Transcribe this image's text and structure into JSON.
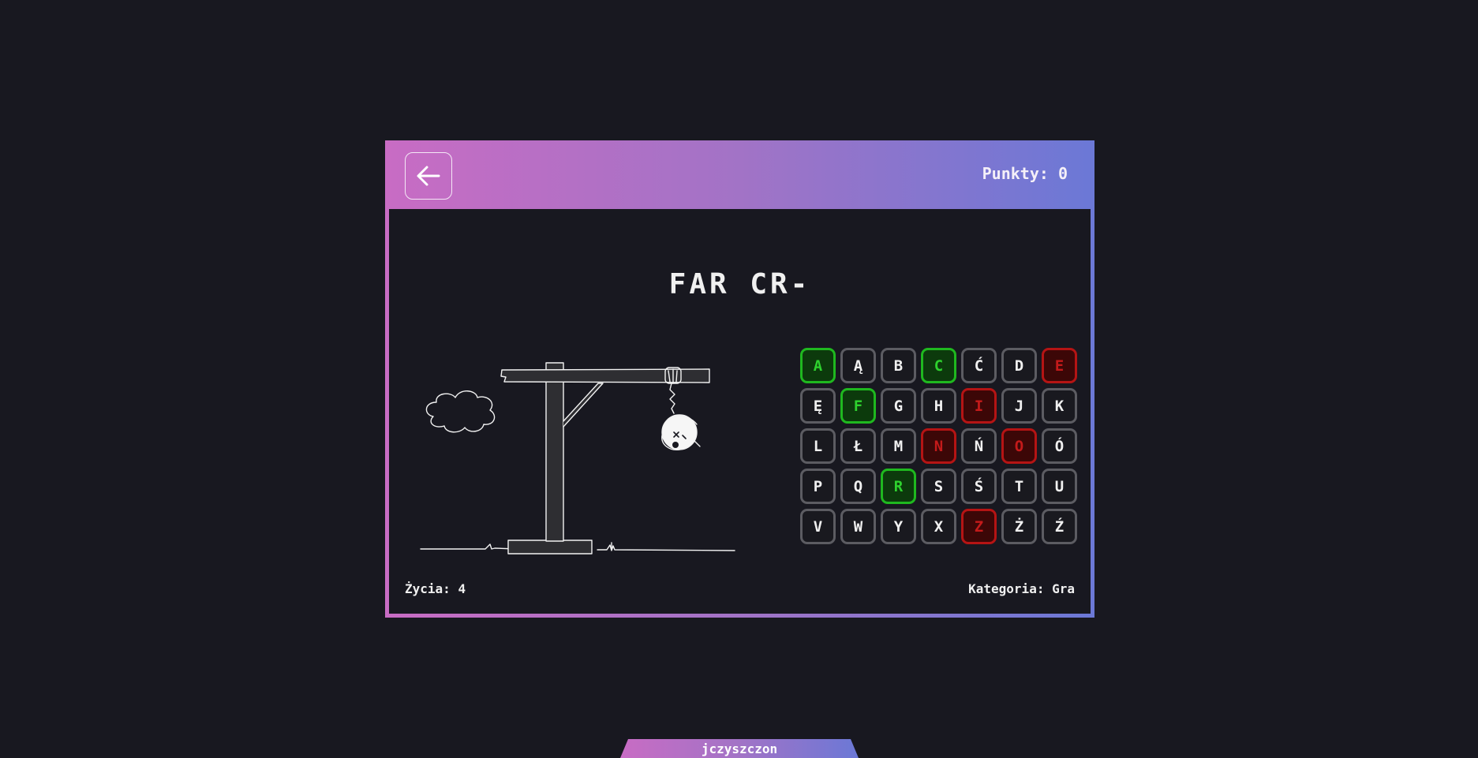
{
  "header": {
    "back_icon": "arrow-left-icon",
    "score_label": "Punkty:",
    "score_value": "0"
  },
  "game": {
    "word": "FAR CR-",
    "lives_label": "Życia:",
    "lives_value": "4",
    "category_label": "Kategoria:",
    "category_value": "Gra"
  },
  "keyboard": [
    {
      "letter": "A",
      "state": "correct"
    },
    {
      "letter": "Ą",
      "state": "default"
    },
    {
      "letter": "B",
      "state": "default"
    },
    {
      "letter": "C",
      "state": "correct"
    },
    {
      "letter": "Ć",
      "state": "default"
    },
    {
      "letter": "D",
      "state": "default"
    },
    {
      "letter": "E",
      "state": "wrong"
    },
    {
      "letter": "Ę",
      "state": "default"
    },
    {
      "letter": "F",
      "state": "correct"
    },
    {
      "letter": "G",
      "state": "default"
    },
    {
      "letter": "H",
      "state": "default"
    },
    {
      "letter": "I",
      "state": "wrong"
    },
    {
      "letter": "J",
      "state": "default"
    },
    {
      "letter": "K",
      "state": "default"
    },
    {
      "letter": "L",
      "state": "default"
    },
    {
      "letter": "Ł",
      "state": "default"
    },
    {
      "letter": "M",
      "state": "default"
    },
    {
      "letter": "N",
      "state": "wrong"
    },
    {
      "letter": "Ń",
      "state": "default"
    },
    {
      "letter": "O",
      "state": "wrong"
    },
    {
      "letter": "Ó",
      "state": "default"
    },
    {
      "letter": "P",
      "state": "default"
    },
    {
      "letter": "Q",
      "state": "default"
    },
    {
      "letter": "R",
      "state": "correct"
    },
    {
      "letter": "S",
      "state": "default"
    },
    {
      "letter": "Ś",
      "state": "default"
    },
    {
      "letter": "T",
      "state": "default"
    },
    {
      "letter": "U",
      "state": "default"
    },
    {
      "letter": "V",
      "state": "default"
    },
    {
      "letter": "W",
      "state": "default"
    },
    {
      "letter": "Y",
      "state": "default"
    },
    {
      "letter": "X",
      "state": "default"
    },
    {
      "letter": "Z",
      "state": "wrong"
    },
    {
      "letter": "Ż",
      "state": "default"
    },
    {
      "letter": "Ź",
      "state": "default"
    }
  ],
  "footer": {
    "author": "jczyszczon"
  },
  "colors": {
    "gradient_start": "#c86cc4",
    "gradient_end": "#6b78d6",
    "background": "#181820",
    "correct": "#1fb81f",
    "wrong": "#b51414"
  }
}
